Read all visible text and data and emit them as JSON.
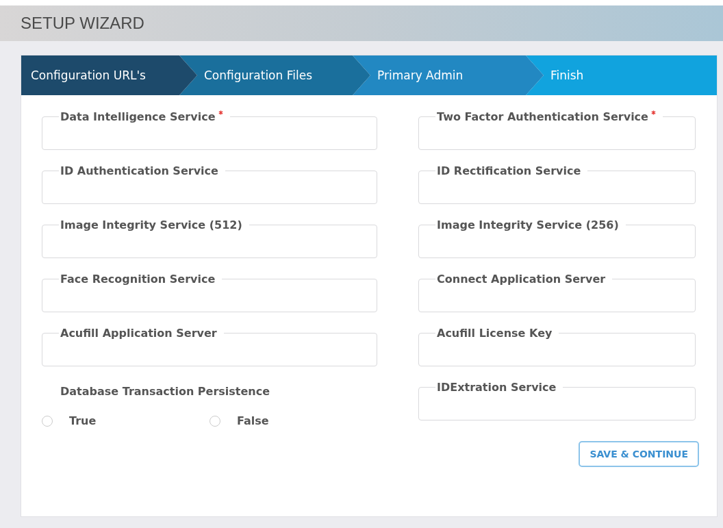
{
  "header": {
    "title": "SETUP WIZARD"
  },
  "steps": [
    {
      "label": "Configuration URL's",
      "color": "#1d4a6b"
    },
    {
      "label": "Configuration Files",
      "color": "#1a6f9c"
    },
    {
      "label": "Primary Admin",
      "color": "#2288c2"
    },
    {
      "label": "Finish",
      "color": "#11a3de"
    }
  ],
  "fields_left": [
    {
      "label": "Data Intelligence Service",
      "required": true
    },
    {
      "label": "ID Authentication Service",
      "required": false
    },
    {
      "label": "Image Integrity Service (512)",
      "required": false
    },
    {
      "label": "Face Recognition Service",
      "required": false
    },
    {
      "label": "Acufill Application Server",
      "required": false
    }
  ],
  "persistence": {
    "label": "Database Transaction Persistence",
    "options": [
      {
        "label": "True",
        "selected": false
      },
      {
        "label": "False",
        "selected": false
      }
    ]
  },
  "fields_right": [
    {
      "label": "Two Factor Authentication Service",
      "required": true
    },
    {
      "label": "ID Rectification Service",
      "required": false
    },
    {
      "label": "Image Integrity Service (256)",
      "required": false
    },
    {
      "label": "Connect Application Server",
      "required": false
    },
    {
      "label": "Acufill License Key",
      "required": false
    },
    {
      "label": "IDExtration Service",
      "required": false
    }
  ],
  "button": "SAVE & CONTINUE"
}
